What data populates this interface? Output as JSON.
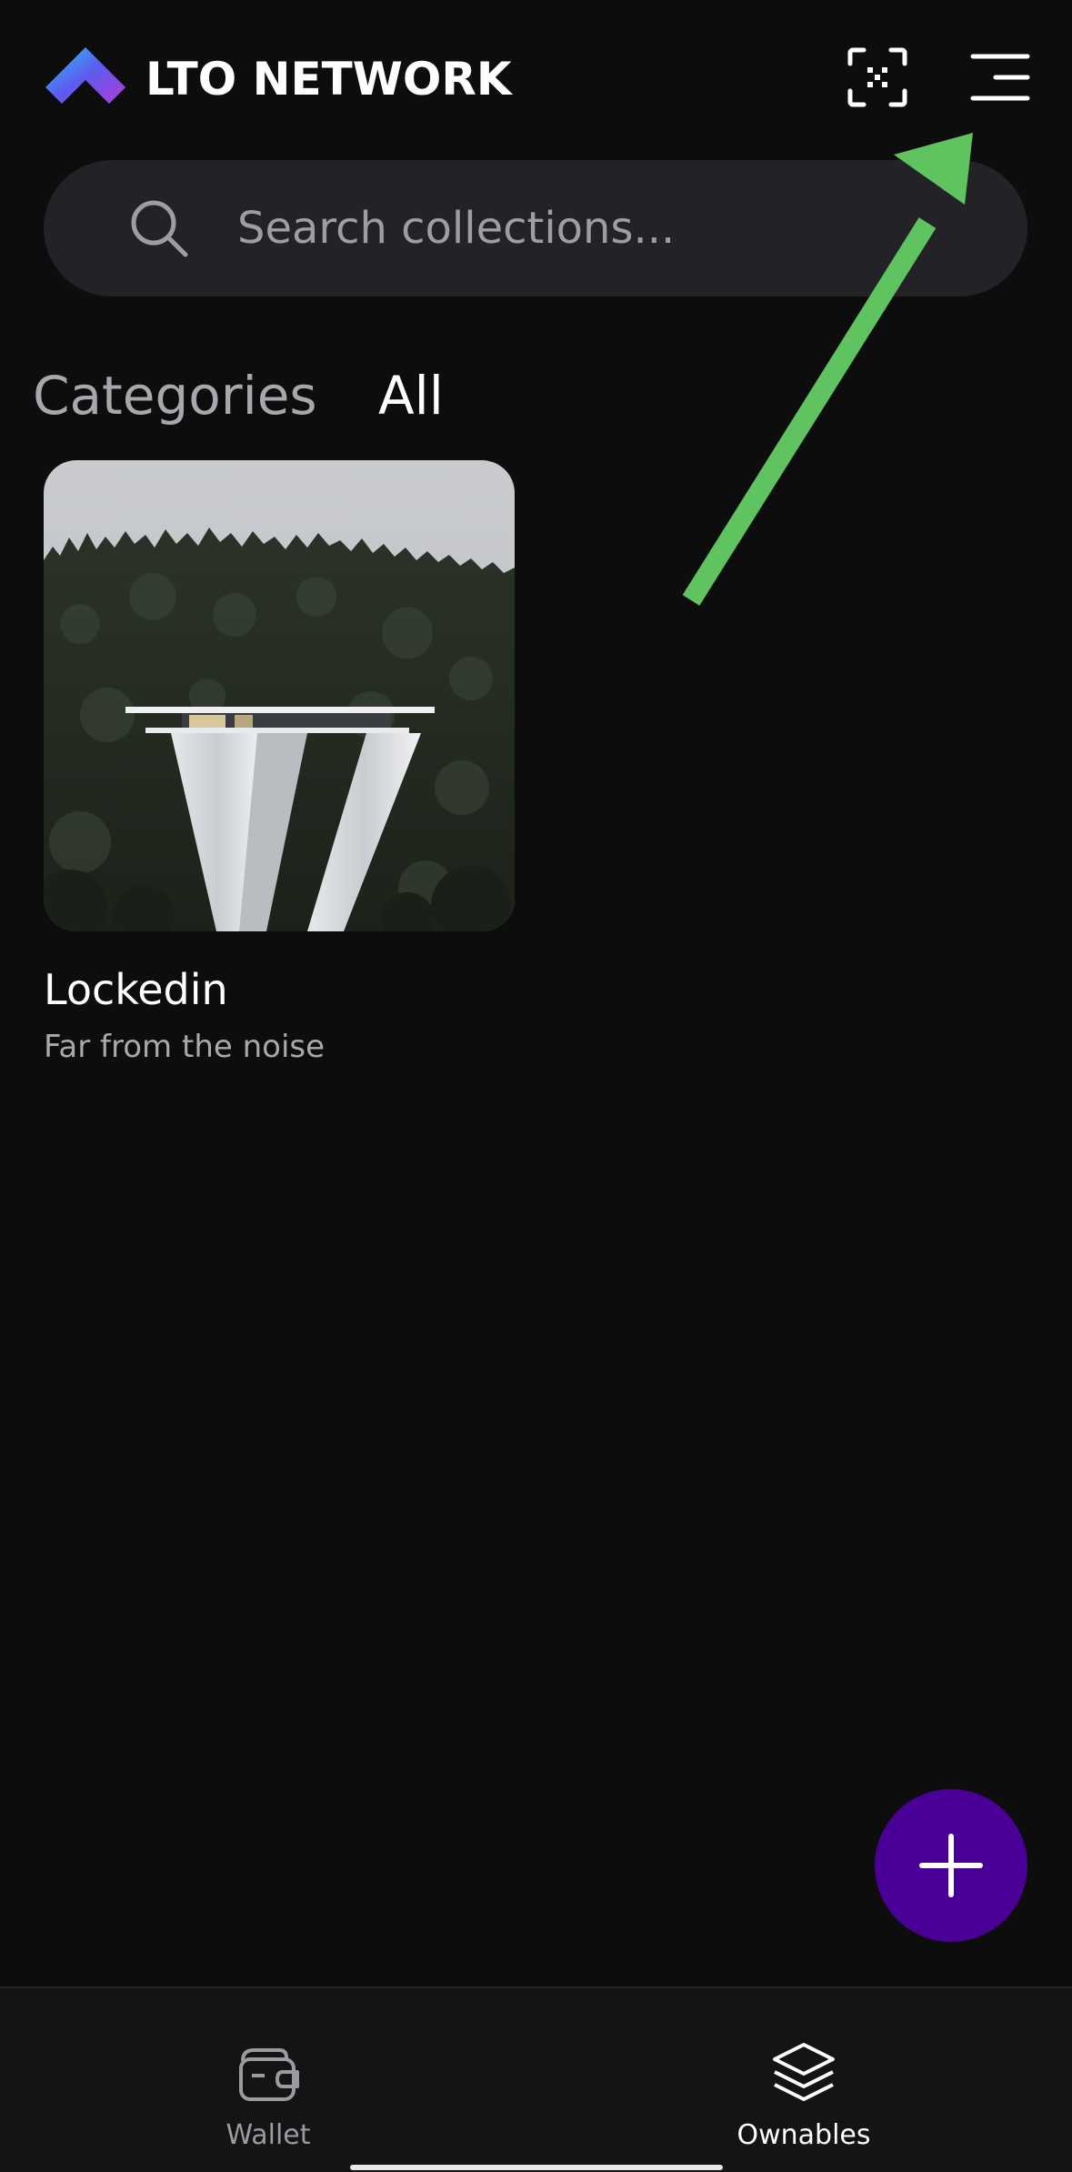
{
  "header": {
    "brand_name": "LTO NETWORK",
    "icons": {
      "logo": "lto-logo-icon",
      "scan": "qr-scan-icon",
      "menu": "menu-icon"
    }
  },
  "search": {
    "placeholder": "Search collections...",
    "value": ""
  },
  "tabs": [
    {
      "label": "Categories",
      "active": false
    },
    {
      "label": "All",
      "active": true
    }
  ],
  "collections": [
    {
      "title": "Lockedin",
      "subtitle": "Far from the noise"
    }
  ],
  "fab": {
    "icon": "plus-icon",
    "color": "#4a0096"
  },
  "bottom_nav": {
    "items": [
      {
        "label": "Wallet",
        "icon": "wallet-icon",
        "active": false
      },
      {
        "label": "Ownables",
        "icon": "layers-icon",
        "active": true
      }
    ]
  },
  "annotation": {
    "arrow_color": "#5fc35f"
  },
  "colors": {
    "background": "#0d0d0e",
    "search_bg": "#232327",
    "nav_bg": "#141415",
    "accent": "#4a0096"
  }
}
